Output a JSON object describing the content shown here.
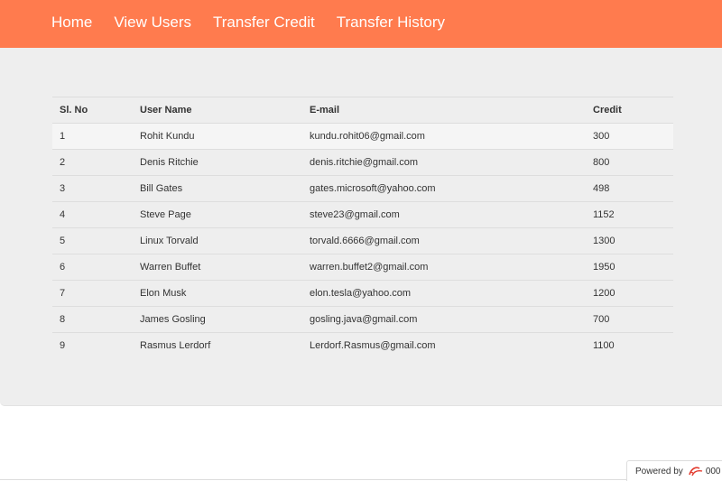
{
  "nav": {
    "items": [
      {
        "label": "Home"
      },
      {
        "label": "View Users"
      },
      {
        "label": "Transfer Credit"
      },
      {
        "label": "Transfer History"
      }
    ]
  },
  "table": {
    "headers": {
      "sl": "Sl. No",
      "name": "User Name",
      "email": "E-mail",
      "credit": "Credit"
    },
    "rows": [
      {
        "sl": "1",
        "name": "Rohit Kundu",
        "email": "kundu.rohit06@gmail.com",
        "credit": "300"
      },
      {
        "sl": "2",
        "name": "Denis Ritchie",
        "email": "denis.ritchie@gmail.com",
        "credit": "800"
      },
      {
        "sl": "3",
        "name": "Bill Gates",
        "email": "gates.microsoft@yahoo.com",
        "credit": "498"
      },
      {
        "sl": "4",
        "name": "Steve Page",
        "email": "steve23@gmail.com",
        "credit": "1152"
      },
      {
        "sl": "5",
        "name": "Linux Torvald",
        "email": "torvald.6666@gmail.com",
        "credit": "1300"
      },
      {
        "sl": "6",
        "name": "Warren Buffet",
        "email": "warren.buffet2@gmail.com",
        "credit": "1950"
      },
      {
        "sl": "7",
        "name": "Elon Musk",
        "email": "elon.tesla@yahoo.com",
        "credit": "1200"
      },
      {
        "sl": "8",
        "name": "James Gosling",
        "email": "gosling.java@gmail.com",
        "credit": "700"
      },
      {
        "sl": "9",
        "name": "Rasmus Lerdorf",
        "email": "Lerdorf.Rasmus@gmail.com",
        "credit": "1100"
      }
    ]
  },
  "footer": {
    "powered_label": "Powered by",
    "brand": "000"
  },
  "colors": {
    "navbar": "#ff7b4e",
    "panel": "#eeeeee",
    "logo": "#e23b2e"
  },
  "icons": {
    "hosting_logo": "swoosh-logo-icon"
  }
}
